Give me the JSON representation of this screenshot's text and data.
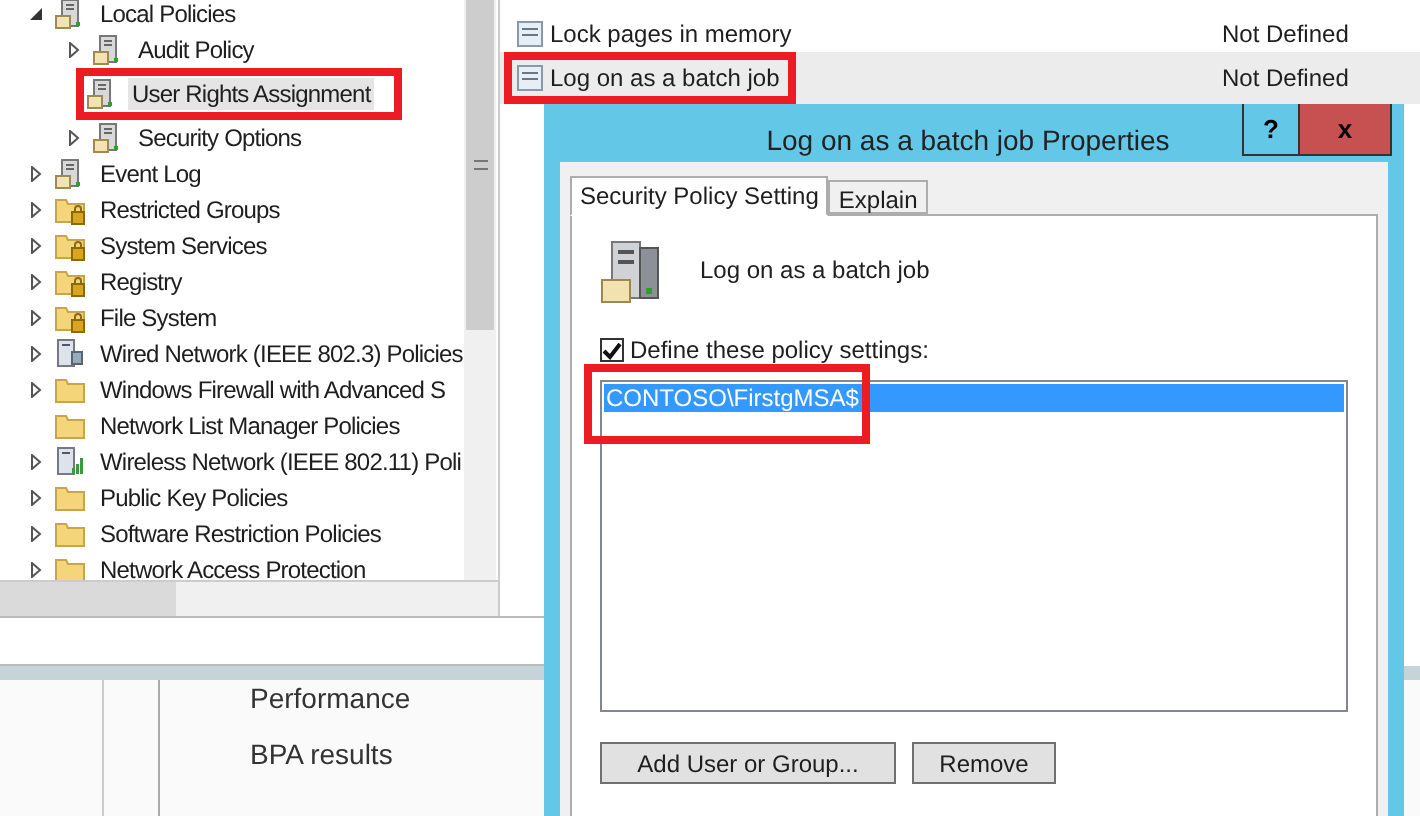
{
  "tree": [
    {
      "label": "Local Policies",
      "kind": "policy",
      "expanded": true,
      "selected": false,
      "highlighted": false,
      "children": [
        {
          "label": "Audit Policy",
          "kind": "policy",
          "expanded": false,
          "selected": false,
          "highlighted": false
        },
        {
          "label": "User Rights Assignment",
          "kind": "policy",
          "selected": true,
          "highlighted": true
        },
        {
          "label": "Security Options",
          "kind": "policy",
          "expanded": false,
          "selected": false,
          "highlighted": false
        }
      ]
    },
    {
      "label": "Event Log",
      "kind": "policy",
      "expanded": false,
      "selected": false,
      "highlighted": false
    },
    {
      "label": "Restricted Groups",
      "kind": "locked-folder",
      "expanded": false,
      "selected": false,
      "highlighted": false
    },
    {
      "label": "System Services",
      "kind": "locked-folder",
      "expanded": false,
      "selected": false,
      "highlighted": false
    },
    {
      "label": "Registry",
      "kind": "locked-folder",
      "expanded": false,
      "selected": false,
      "highlighted": false
    },
    {
      "label": "File System",
      "kind": "locked-folder",
      "expanded": false,
      "selected": false,
      "highlighted": false
    },
    {
      "label": "Wired Network (IEEE 802.3) Policies",
      "kind": "network",
      "expanded": false,
      "selected": false,
      "highlighted": false
    },
    {
      "label": "Windows Firewall with Advanced S",
      "kind": "folder",
      "expanded": false,
      "selected": false,
      "highlighted": false
    },
    {
      "label": "Network List Manager Policies",
      "kind": "folder",
      "selected": false,
      "highlighted": false
    },
    {
      "label": "Wireless Network (IEEE 802.11) Poli",
      "kind": "wireless",
      "expanded": false,
      "selected": false,
      "highlighted": false
    },
    {
      "label": "Public Key Policies",
      "kind": "folder",
      "expanded": false,
      "selected": false,
      "highlighted": false
    },
    {
      "label": "Software Restriction Policies",
      "kind": "folder",
      "expanded": false,
      "selected": false,
      "highlighted": false
    },
    {
      "label": "Network Access Protection",
      "kind": "folder",
      "expanded": false,
      "selected": false,
      "highlighted": false
    }
  ],
  "policies": [
    {
      "name": "Lock pages in memory",
      "setting": "Not Defined",
      "selected": false,
      "highlighted": false
    },
    {
      "name": "Log on as a batch job",
      "setting": "Not Defined",
      "selected": true,
      "highlighted": true
    }
  ],
  "server_manager": {
    "items": [
      "Performance",
      "BPA results"
    ]
  },
  "dialog": {
    "title": "Log on as a batch job Properties",
    "help": "?",
    "close": "x",
    "tabs": [
      {
        "label": "Security Policy Setting",
        "selected": true
      },
      {
        "label": "Explain",
        "selected": false
      }
    ],
    "policy_name": "Log on as a batch job",
    "define": {
      "label": "Define these policy settings:",
      "checked": true
    },
    "accounts": [
      {
        "name": "CONTOSO\\FirstgMSA$",
        "selected": true,
        "highlighted": true
      }
    ],
    "buttons": [
      "Add User or Group...",
      "Remove"
    ]
  }
}
